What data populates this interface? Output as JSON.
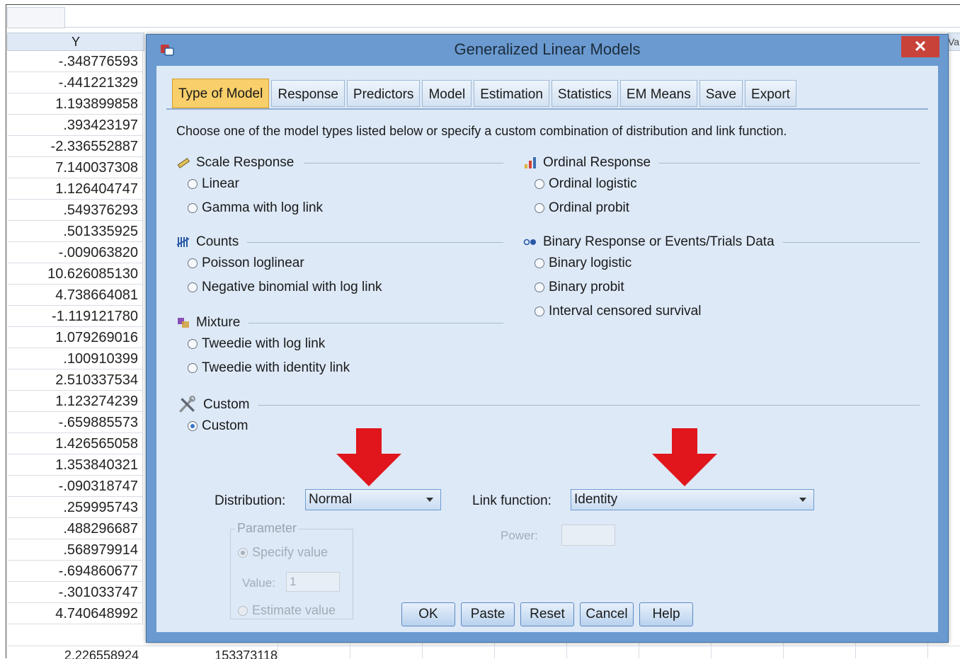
{
  "sheet": {
    "column_header": "Y",
    "column_header_2": "Va",
    "y_values": [
      "-.348776593",
      "-.441221329",
      "1.193899858",
      ".393423197",
      "-2.336552887",
      "7.140037308",
      "1.126404747",
      ".549376293",
      ".501335925",
      "-.009063820",
      "10.626085130",
      "4.738664081",
      "-1.119121780",
      "1.079269016",
      ".100910399",
      "2.510337534",
      "1.123274239",
      "-.659885573",
      "1.426565058",
      "1.353840321",
      "-.090318747",
      ".259995743",
      ".488296687",
      ".568979914",
      "-.694860677",
      "-.301033747",
      "4.740648992"
    ],
    "bottom_row": [
      "2.226558924",
      "153373118"
    ]
  },
  "dialog": {
    "title": "Generalized Linear Models",
    "close_label": "✕",
    "tabs": [
      "Type of Model",
      "Response",
      "Predictors",
      "Model",
      "Estimation",
      "Statistics",
      "EM Means",
      "Save",
      "Export"
    ],
    "active_tab": "Type of Model",
    "intro": "Choose one of the model types listed below or specify a custom combination of distribution and link function.",
    "scale": {
      "title": "Scale Response",
      "icon": "ruler-icon",
      "options": [
        "Linear",
        "Gamma with log link"
      ]
    },
    "ordinal": {
      "title": "Ordinal Response",
      "icon": "bar-chart-icon",
      "options": [
        "Ordinal logistic",
        "Ordinal probit"
      ]
    },
    "counts": {
      "title": "Counts",
      "icon": "tally-icon",
      "options": [
        "Poisson loglinear",
        "Negative binomial with log link"
      ]
    },
    "binary": {
      "title": "Binary Response or Events/Trials Data",
      "icon": "binary-icon",
      "options": [
        "Binary logistic",
        "Binary probit",
        "Interval censored survival"
      ]
    },
    "mixture": {
      "title": "Mixture",
      "icon": "mixture-icon",
      "options": [
        "Tweedie with log link",
        "Tweedie with identity link"
      ]
    },
    "custom": {
      "title": "Custom",
      "icon": "tools-icon",
      "options": [
        "Custom"
      ],
      "selected": "Custom"
    },
    "distribution": {
      "label": "Distribution:",
      "value": "Normal"
    },
    "link_function": {
      "label": "Link function:",
      "value": "Identity"
    },
    "parameter": {
      "legend": "Parameter",
      "specify_label": "Specify value",
      "value_label": "Value:",
      "value": "1",
      "estimate_label": "Estimate value"
    },
    "power": {
      "label": "Power:",
      "value": ""
    },
    "buttons": [
      "OK",
      "Paste",
      "Reset",
      "Cancel",
      "Help"
    ]
  },
  "colors": {
    "arrow": "#e0161c",
    "active_tab": "#f8cf6a",
    "dialog_frame": "#6a9ad0"
  }
}
